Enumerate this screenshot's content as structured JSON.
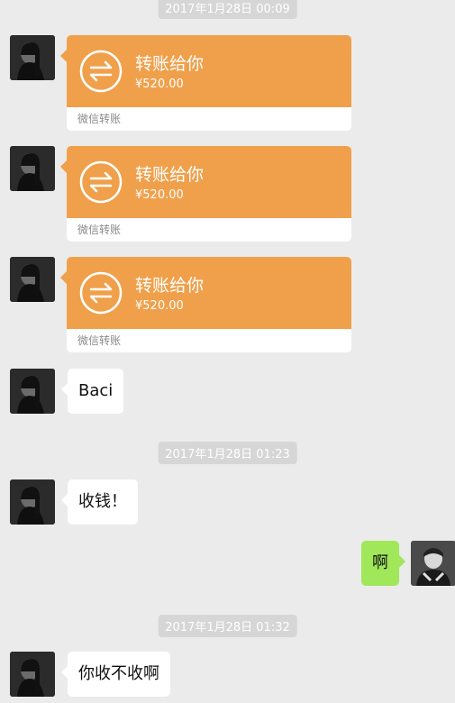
{
  "timestamps": [
    "2017年1月28日 00:09",
    "2017年1月28日 01:23",
    "2017年1月28日 01:32"
  ],
  "transfers": [
    {
      "title": "转账给你",
      "amount": "¥520.00",
      "footer": "微信转账"
    },
    {
      "title": "转账给你",
      "amount": "¥520.00",
      "footer": "微信转账"
    },
    {
      "title": "转账给你",
      "amount": "¥520.00",
      "footer": "微信转账"
    }
  ],
  "messages": [
    {
      "side": "left",
      "text": "Baci"
    },
    {
      "side": "left",
      "text": "收钱！"
    },
    {
      "side": "right",
      "text": "啊"
    },
    {
      "side": "left",
      "text": "你收不收啊"
    }
  ],
  "colors": {
    "background": "#ebebeb",
    "transfer_orange": "#f0a04b",
    "own_bubble_green": "#a0e75a",
    "timestamp_bg": "#d6d6d6"
  },
  "icons": {
    "transfer": "transfer-arrows-icon",
    "contact_avatar": "avatar",
    "self_avatar": "avatar"
  }
}
